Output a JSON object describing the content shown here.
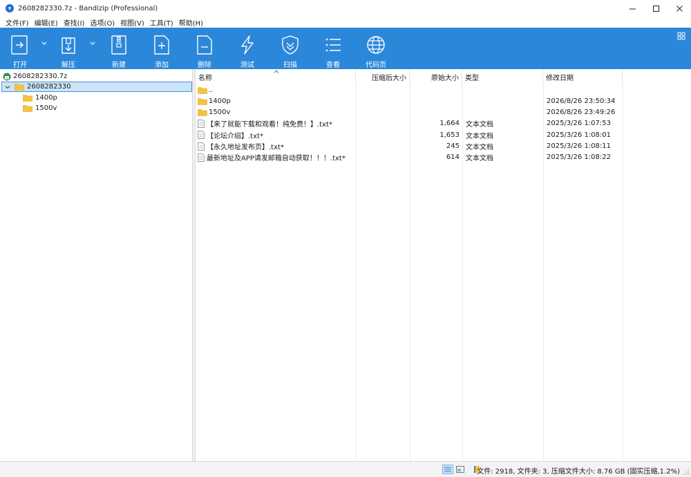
{
  "window": {
    "title": "2608282330.7z - Bandizip (Professional)"
  },
  "menu": [
    "文件(F)",
    "编辑(E)",
    "查找(I)",
    "选项(O)",
    "视图(V)",
    "工具(T)",
    "帮助(H)"
  ],
  "toolbar": {
    "open": "打开",
    "extract": "解压",
    "new": "新建",
    "add": "添加",
    "delete": "删除",
    "test": "测试",
    "scan": "扫描",
    "view": "查看",
    "codepage": "代码页"
  },
  "tree": {
    "archive": "2608282330.7z",
    "root": "2608282330",
    "children": [
      "1400p",
      "1500v"
    ]
  },
  "columns": {
    "name": "名称",
    "compressed": "压缩后大小",
    "original": "原始大小",
    "type": "类型",
    "modified": "修改日期"
  },
  "rows": [
    {
      "name": "..",
      "icon": "folder-icon",
      "compressed": "",
      "original": "",
      "type": "",
      "modified": ""
    },
    {
      "name": "1400p",
      "icon": "folder-icon",
      "compressed": "",
      "original": "",
      "type": "",
      "modified": "2026/8/26 23:50:34"
    },
    {
      "name": "1500v",
      "icon": "folder-icon",
      "compressed": "",
      "original": "",
      "type": "",
      "modified": "2026/8/26 23:49:26"
    },
    {
      "name": "【来了就能下载和观看！纯免费！】.txt*",
      "icon": "text-file-icon",
      "compressed": "",
      "original": "1,664",
      "type": "文本文档",
      "modified": "2025/3/26 1:07:53"
    },
    {
      "name": "【论坛介绍】.txt*",
      "icon": "text-file-icon",
      "compressed": "",
      "original": "1,653",
      "type": "文本文档",
      "modified": "2025/3/26 1:08:01"
    },
    {
      "name": "【永久地址发布页】.txt*",
      "icon": "text-file-icon",
      "compressed": "",
      "original": "245",
      "type": "文本文档",
      "modified": "2025/3/26 1:08:11"
    },
    {
      "name": "最新地址及APP请发邮箱自动获取！！！.txt*",
      "icon": "text-file-icon",
      "compressed": "",
      "original": "614",
      "type": "文本文档",
      "modified": "2025/3/26 1:08:22"
    }
  ],
  "status": {
    "text": "文件: 2918, 文件夹: 3, 压缩文件大小: 8.76 GB (固实压缩,1.2%)"
  },
  "colors": {
    "toolbar": "#2b87d9",
    "selection": "#cce4f7",
    "folder": "#f5c342"
  }
}
